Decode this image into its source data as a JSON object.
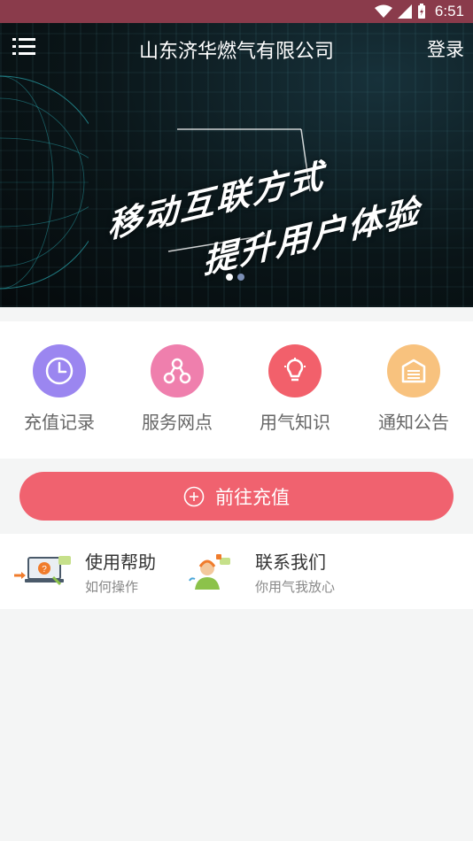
{
  "status_bar": {
    "time": "6:51"
  },
  "header": {
    "title": "山东济华燃气有限公司",
    "login_label": "登录"
  },
  "banner": {
    "slogan_line1": "移动互联方式",
    "slogan_line2": "提升用户体验",
    "slide_count": 2,
    "active_slide": 1
  },
  "quick_actions": [
    {
      "label": "充值记录",
      "icon": "clock-icon",
      "color": "#9b86f0"
    },
    {
      "label": "服务网点",
      "icon": "network-icon",
      "color": "#ef7fad"
    },
    {
      "label": "用气知识",
      "icon": "lightbulb-icon",
      "color": "#f2606b"
    },
    {
      "label": "通知公告",
      "icon": "notice-icon",
      "color": "#f8c27e"
    }
  ],
  "recharge_button": {
    "label": "前往充值",
    "color": "#f0626f"
  },
  "help_items": [
    {
      "title": "使用帮助",
      "subtitle": "如何操作",
      "icon": "help-laptop-icon"
    },
    {
      "title": "联系我们",
      "subtitle": "你用气我放心",
      "icon": "customer-service-icon"
    }
  ]
}
